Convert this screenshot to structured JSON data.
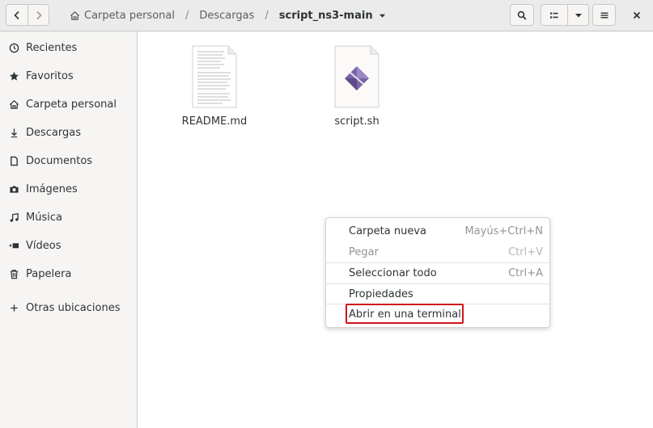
{
  "header": {
    "path": [
      {
        "label": "Carpeta personal",
        "icon": "home-icon"
      },
      {
        "label": "Descargas"
      },
      {
        "label": "script_ns3-main",
        "current": true
      }
    ],
    "separator": "/"
  },
  "sidebar": {
    "items": [
      {
        "label": "Recientes",
        "icon": "clock-icon"
      },
      {
        "label": "Favoritos",
        "icon": "star-icon"
      },
      {
        "label": "Carpeta personal",
        "icon": "home-icon"
      },
      {
        "label": "Descargas",
        "icon": "download-icon"
      },
      {
        "label": "Documentos",
        "icon": "document-icon"
      },
      {
        "label": "Imágenes",
        "icon": "camera-icon"
      },
      {
        "label": "Música",
        "icon": "music-icon"
      },
      {
        "label": "Vídeos",
        "icon": "video-icon"
      },
      {
        "label": "Papelera",
        "icon": "trash-icon"
      },
      {
        "label": "Otras ubicaciones",
        "icon": "plus-icon"
      }
    ]
  },
  "files": [
    {
      "name": "README.md",
      "icon": "text-document-icon"
    },
    {
      "name": "script.sh",
      "icon": "script-file-icon"
    }
  ],
  "context_menu": {
    "items": [
      {
        "label": "Carpeta nueva",
        "accel": "Mayús+Ctrl+N",
        "enabled": true
      },
      {
        "label": "Pegar",
        "accel": "Ctrl+V",
        "enabled": false
      },
      {
        "label": "Seleccionar todo",
        "accel": "Ctrl+A",
        "enabled": true
      },
      {
        "label": "Propiedades",
        "accel": "",
        "enabled": true
      },
      {
        "label": "Abrir en una terminal",
        "accel": "",
        "enabled": true,
        "highlighted": true
      }
    ],
    "highlight_color": "#d0141c"
  },
  "colors": {
    "headerbar": "#ebebeb",
    "sidebar": "#f6f5f4",
    "border": "#cdc7c2",
    "text": "#2e3436"
  }
}
